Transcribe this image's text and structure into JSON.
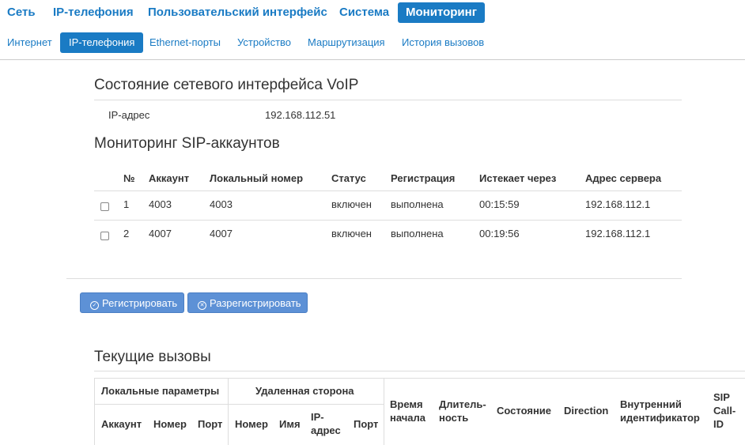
{
  "nav_top": [
    {
      "label": "Сеть",
      "active": false
    },
    {
      "label": "IP-телефония",
      "active": false
    },
    {
      "label": "Пользовательский интерфейс",
      "active": false
    },
    {
      "label": "Система",
      "active": false
    },
    {
      "label": "Мониторинг",
      "active": true
    }
  ],
  "nav_sub": [
    {
      "label": "Интернет",
      "active": false
    },
    {
      "label": "IP-телефония",
      "active": true
    },
    {
      "label": "Ethernet-порты",
      "active": false
    },
    {
      "label": "Устройство",
      "active": false
    },
    {
      "label": "Маршрутизация",
      "active": false
    },
    {
      "label": "История вызовов",
      "active": false
    }
  ],
  "voip": {
    "title": "Состояние сетевого интерфейса VoIP",
    "ip_label": "IP-адрес",
    "ip_value": "192.168.112.51"
  },
  "sip": {
    "title": "Мониторинг SIP-аккаунтов",
    "headers": [
      "№",
      "Аккаунт",
      "Локальный номер",
      "Статус",
      "Регистрация",
      "Истекает через",
      "Адрес сервера"
    ],
    "rows": [
      [
        "1",
        "4003",
        "4003",
        "включен",
        "выполнена",
        "00:15:59",
        "192.168.112.1"
      ],
      [
        "2",
        "4007",
        "4007",
        "включен",
        "выполнена",
        "00:19:56",
        "192.168.112.1"
      ]
    ]
  },
  "buttons": {
    "register": "Регистрировать",
    "unregister": "Разрегистрировать"
  },
  "calls": {
    "title": "Текущие вызовы",
    "group_local": "Локальные параметры",
    "group_remote": "Удаленная сторона",
    "local_cols": [
      "Аккаунт",
      "Номер",
      "Порт"
    ],
    "remote_cols": [
      "Номер",
      "Имя",
      "IP-адрес",
      "Порт"
    ],
    "start_time": "Время начала",
    "duration": "Длитель-ность",
    "state": "Состояние",
    "direction": "Direction",
    "internal_id": "Внутренний идентификатор",
    "sip_call_id": "SIP Call-ID"
  },
  "colors": {
    "accent": "#1a7bc4",
    "button": "#5d91d6"
  }
}
